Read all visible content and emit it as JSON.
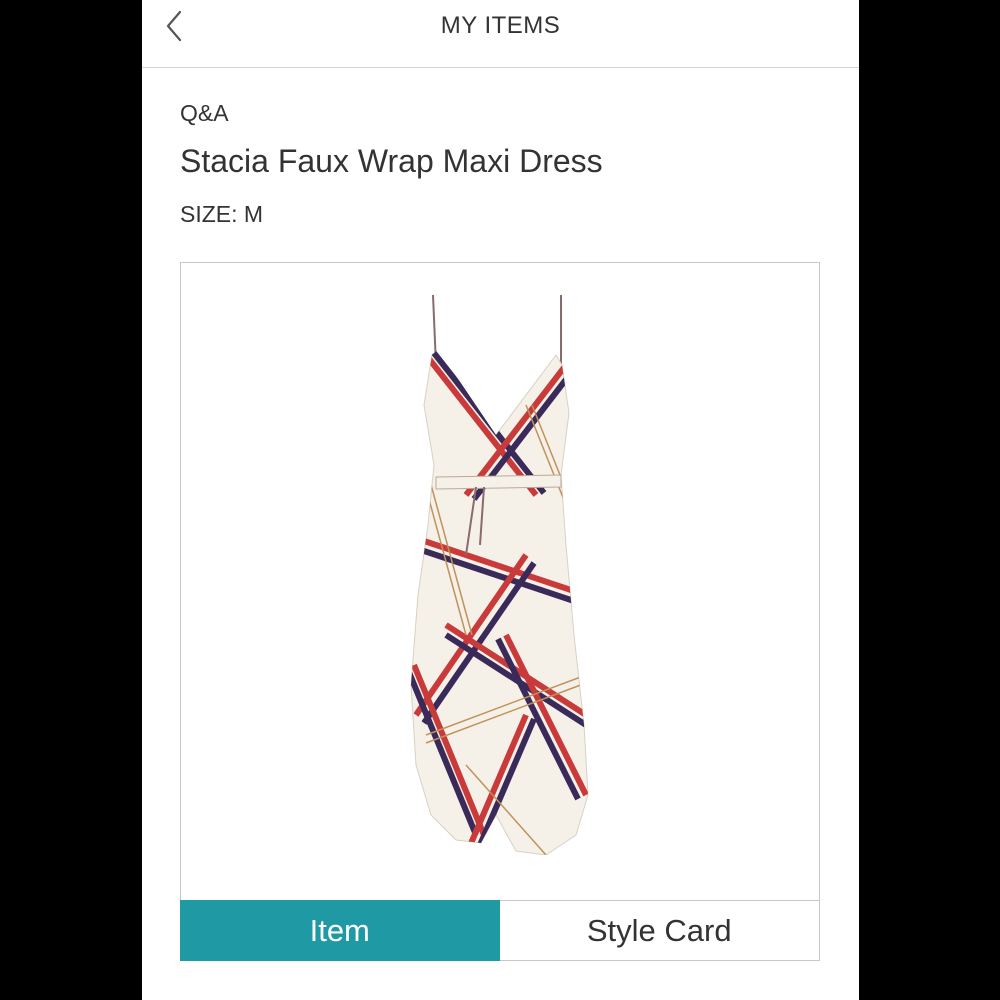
{
  "nav": {
    "title": "MY ITEMS",
    "back_icon": "chevron-left-icon"
  },
  "content": {
    "section_label": "Q&A",
    "product_name": "Stacia Faux Wrap Maxi Dress",
    "size": "SIZE: M",
    "image_subject": "striped wrap maxi dress"
  },
  "tabs": [
    {
      "label": "Item",
      "selected": true
    },
    {
      "label": "Style Card",
      "selected": false
    }
  ],
  "colors": {
    "accent": "#1f9aa5",
    "text": "#333333",
    "border": "#c8c8c8",
    "frame": "#000000"
  }
}
